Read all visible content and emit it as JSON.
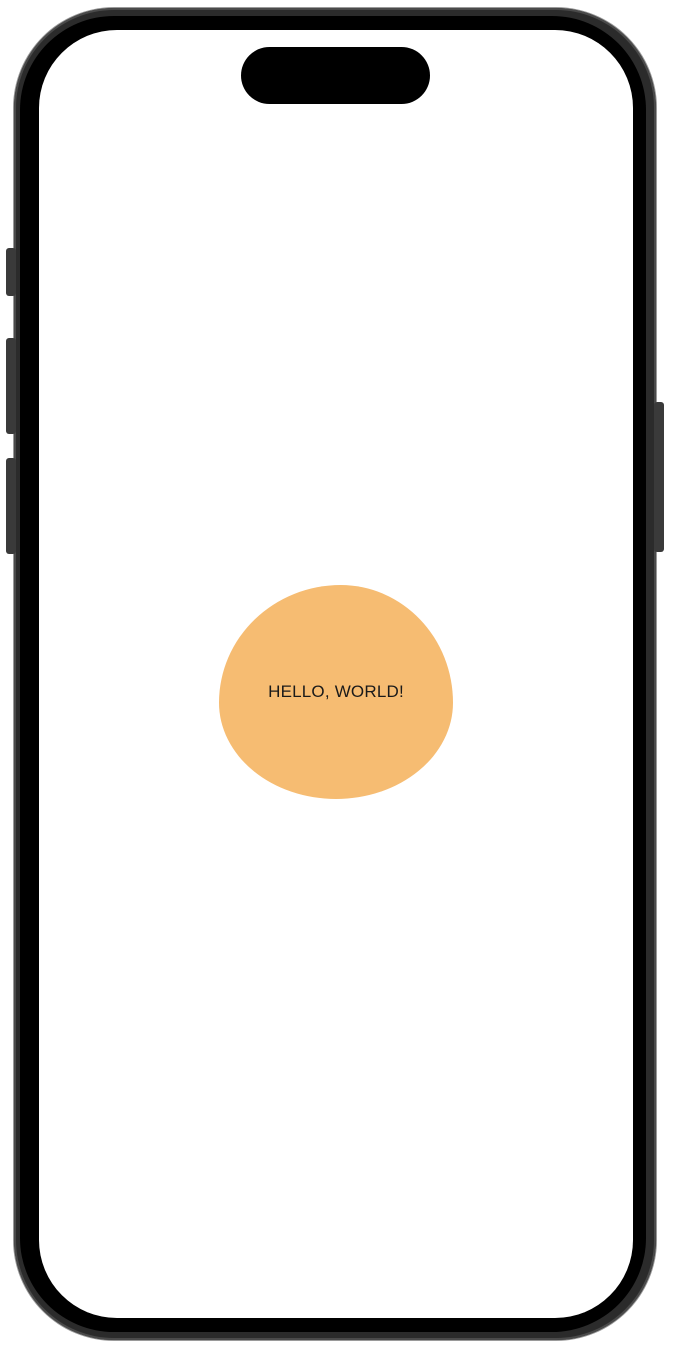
{
  "screen": {
    "background_color": "#ffffff",
    "blob": {
      "label": "HELLO, WORLD!",
      "color": "#f6bc72"
    }
  },
  "device": {
    "frame_color": "#2b2b2b",
    "bezel_color": "#000000"
  }
}
